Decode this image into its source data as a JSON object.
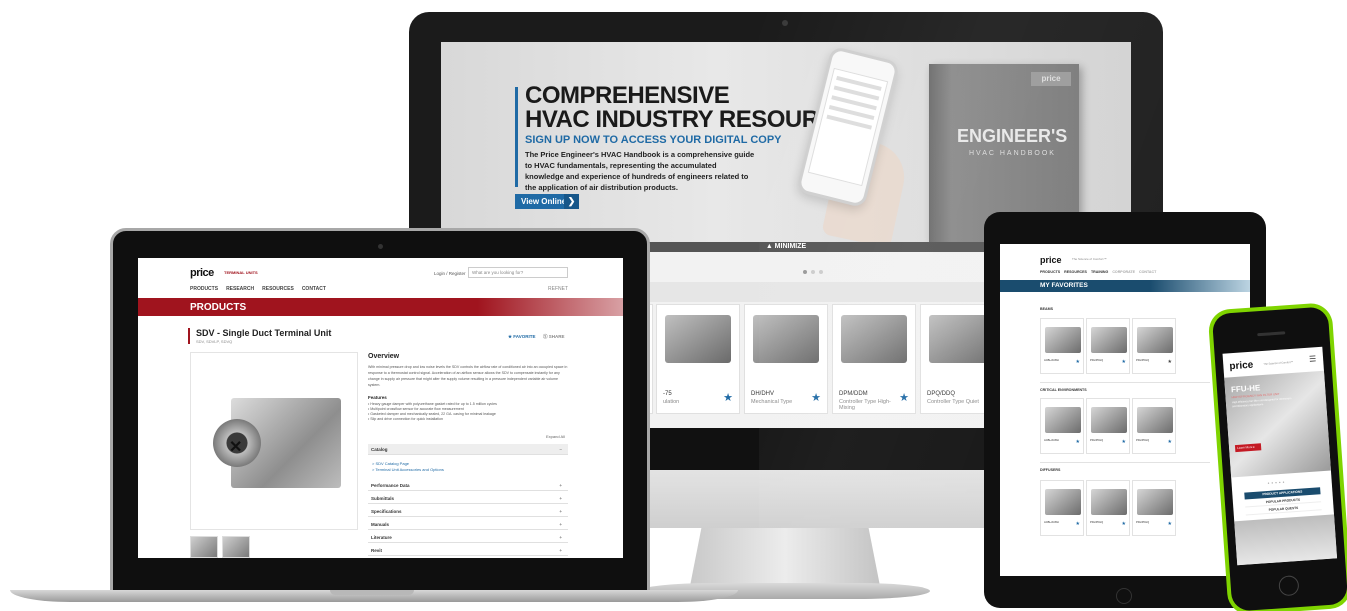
{
  "desktop": {
    "hero": {
      "title_line1": "COMPREHENSIVE",
      "title_line2": "HVAC INDUSTRY RESOURCE",
      "subtitle": "SIGN UP NOW TO ACCESS YOUR DIGITAL COPY",
      "body": "The Price Engineer's HVAC Handbook is a comprehensive guide to HVAC fundamentals, representing the accumulated knowledge and experience of hundreds of engineers related to the application of air distribution products.",
      "button_label": "View Online",
      "book_logo": "price",
      "book_title": "ENGINEER'S",
      "book_subtitle": "HVAC HANDBOOK"
    },
    "minimize_label": "▲ MINIMIZE",
    "cards": [
      {
        "name": "DH/DHV",
        "type": "Mechanical Type"
      },
      {
        "name": "DPM/DDM",
        "type": "Controller Type High-Mixing"
      },
      {
        "name": "DPQ/DDQ",
        "type": "Controller Type Quiet"
      }
    ],
    "partial_card": {
      "name": "-75",
      "type": "ulation"
    }
  },
  "laptop": {
    "logo": "price",
    "logo_tag": "TERMINAL UNITS",
    "login": "Login / Register",
    "search_placeholder": "What are you looking for?",
    "nav": [
      "PRODUCTS",
      "RESEARCH",
      "RESOURCES",
      "CONTACT"
    ],
    "refnet": "REFNET",
    "banner": "PRODUCTS",
    "product_title": "SDV - Single Duct Terminal Unit",
    "product_models": "SDV, SDVLP, SDVQ",
    "favorite": "FAVORITE",
    "share": "SHARE",
    "overview_title": "Overview",
    "overview_text": "With minimal pressure drop and low noise levels the SDV controls the airflow rate of conditioned air into an occupied space in response to a thermostat control signal. Acceleration of an airflow sensor allows the SDV to compensate instantly for any change in supply air pressure that might alter the supply volume resulting in a pressure independent variable air volume system.",
    "features_title": "Features",
    "features": [
      "• Heavy gauge damper with polyurethane gasket rated for up to 1.5 million cycles",
      "• Multipoint crossflow sensor for accurate flow measurement",
      "• Gasketed damper and mechanically sealed, 22 GA. casing for minimal leakage",
      "• Slip and drive connection for quick installation"
    ],
    "expand_all": "Expand All",
    "accordion": [
      {
        "label": "Catalog",
        "sign": "−"
      },
      {
        "label": "Performance Data",
        "sign": "+"
      },
      {
        "label": "Submittals",
        "sign": "+"
      },
      {
        "label": "Specifications",
        "sign": "+"
      },
      {
        "label": "Manuals",
        "sign": "+"
      },
      {
        "label": "Literature",
        "sign": "+"
      },
      {
        "label": "Revit",
        "sign": "+"
      }
    ],
    "catalog_links": [
      "> SDV Catalog Page",
      "> Terminal Unit Accessories and Options"
    ]
  },
  "tablet": {
    "logo": "price",
    "logo_tag": "The Science of Comfort™",
    "nav": [
      "PRODUCTS",
      "RESOURCES",
      "TRAINING"
    ],
    "nav_muted": [
      "CORPORATE",
      "CONTACT"
    ],
    "banner": "MY FAVORITES",
    "sections": [
      "BEAMS",
      "CRITICAL ENVIRONMENTS",
      "DIFFUSERS"
    ],
    "card_names": [
      "ACBL/ACBH",
      "PFH/PFHQ",
      "PFH/PFHQ"
    ]
  },
  "phone": {
    "logo": "price",
    "logo_tag": "The Science of Comfort™",
    "hero_title": "FFU-HE",
    "hero_sub": "HIGH EFFICIENCY FAN FILTER UNIT",
    "hero_body": "High efficiency fan filter unit designed for cleanroom and laboratory applications.",
    "learn_more": "Learn More ▸",
    "pills": [
      "PRODUCT APPLICATIONS",
      "POPULAR PRODUCTS",
      "POPULAR QUESTS"
    ]
  }
}
